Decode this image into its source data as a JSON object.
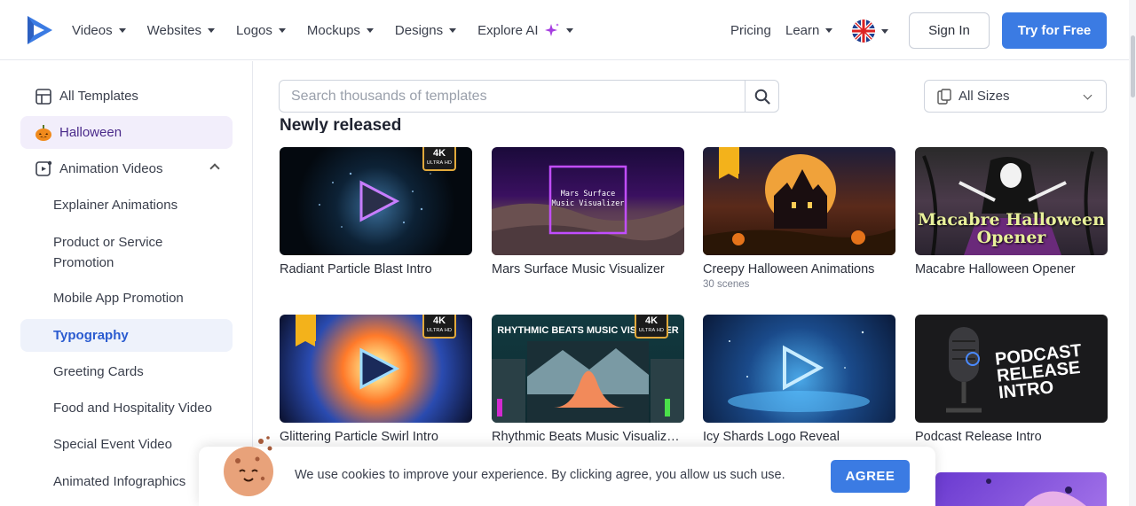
{
  "nav": {
    "items": [
      {
        "label": "Videos"
      },
      {
        "label": "Websites"
      },
      {
        "label": "Logos"
      },
      {
        "label": "Mockups"
      },
      {
        "label": "Designs"
      },
      {
        "label": "Explore AI"
      }
    ],
    "pricing": "Pricing",
    "learn": "Learn",
    "signin": "Sign In",
    "try_free": "Try for Free"
  },
  "sidebar": {
    "items": [
      {
        "label": "All Templates",
        "icon": "layout-grid-icon"
      },
      {
        "label": "Halloween",
        "icon": "pumpkin-icon"
      },
      {
        "label": "Animation Videos",
        "icon": "video-play-icon"
      },
      {
        "label": "Explainer Animations"
      },
      {
        "label": "Product or Service Promotion"
      },
      {
        "label": "Mobile App Promotion"
      },
      {
        "label": "Typography"
      },
      {
        "label": "Greeting Cards"
      },
      {
        "label": "Food and Hospitality Video"
      },
      {
        "label": "Special Event Video"
      },
      {
        "label": "Animated Infographics"
      }
    ]
  },
  "search": {
    "placeholder": "Search thousands of templates"
  },
  "size_filter": {
    "label": "All Sizes"
  },
  "section": {
    "title": "Newly released"
  },
  "cards": [
    {
      "title": "Radiant Particle Blast Intro",
      "badge": "4K",
      "badge_sub": "ULTRA HD"
    },
    {
      "title": "Mars Surface Music Visualizer",
      "thumb_text": "Mars Surface Music Visualizer"
    },
    {
      "title": "Creepy Halloween Animations",
      "subtitle": "30 scenes",
      "premium": true
    },
    {
      "title": "Macabre Halloween Opener",
      "thumb_text": "Macabre Halloween Opener"
    },
    {
      "title": "Glittering Particle Swirl Intro",
      "badge": "4K",
      "badge_sub": "ULTRA HD",
      "premium": true
    },
    {
      "title": "Rhythmic Beats Music Visualiz…",
      "badge": "4K",
      "badge_sub": "ULTRA HD",
      "thumb_text": "RHYTHMIC BEATS MUSIC VISUALIZER"
    },
    {
      "title": "Icy Shards Logo Reveal"
    },
    {
      "title": "Podcast Release Intro",
      "thumb_text": "PODCAST RELEASE INTRO"
    }
  ],
  "cookie": {
    "text": "We use cookies to improve your experience. By clicking agree, you allow us such use.",
    "agree": "AGREE"
  },
  "colors": {
    "accent": "#3b7be3",
    "halloween_bg": "#f2eefb",
    "typography_bg": "#eef2fb"
  }
}
